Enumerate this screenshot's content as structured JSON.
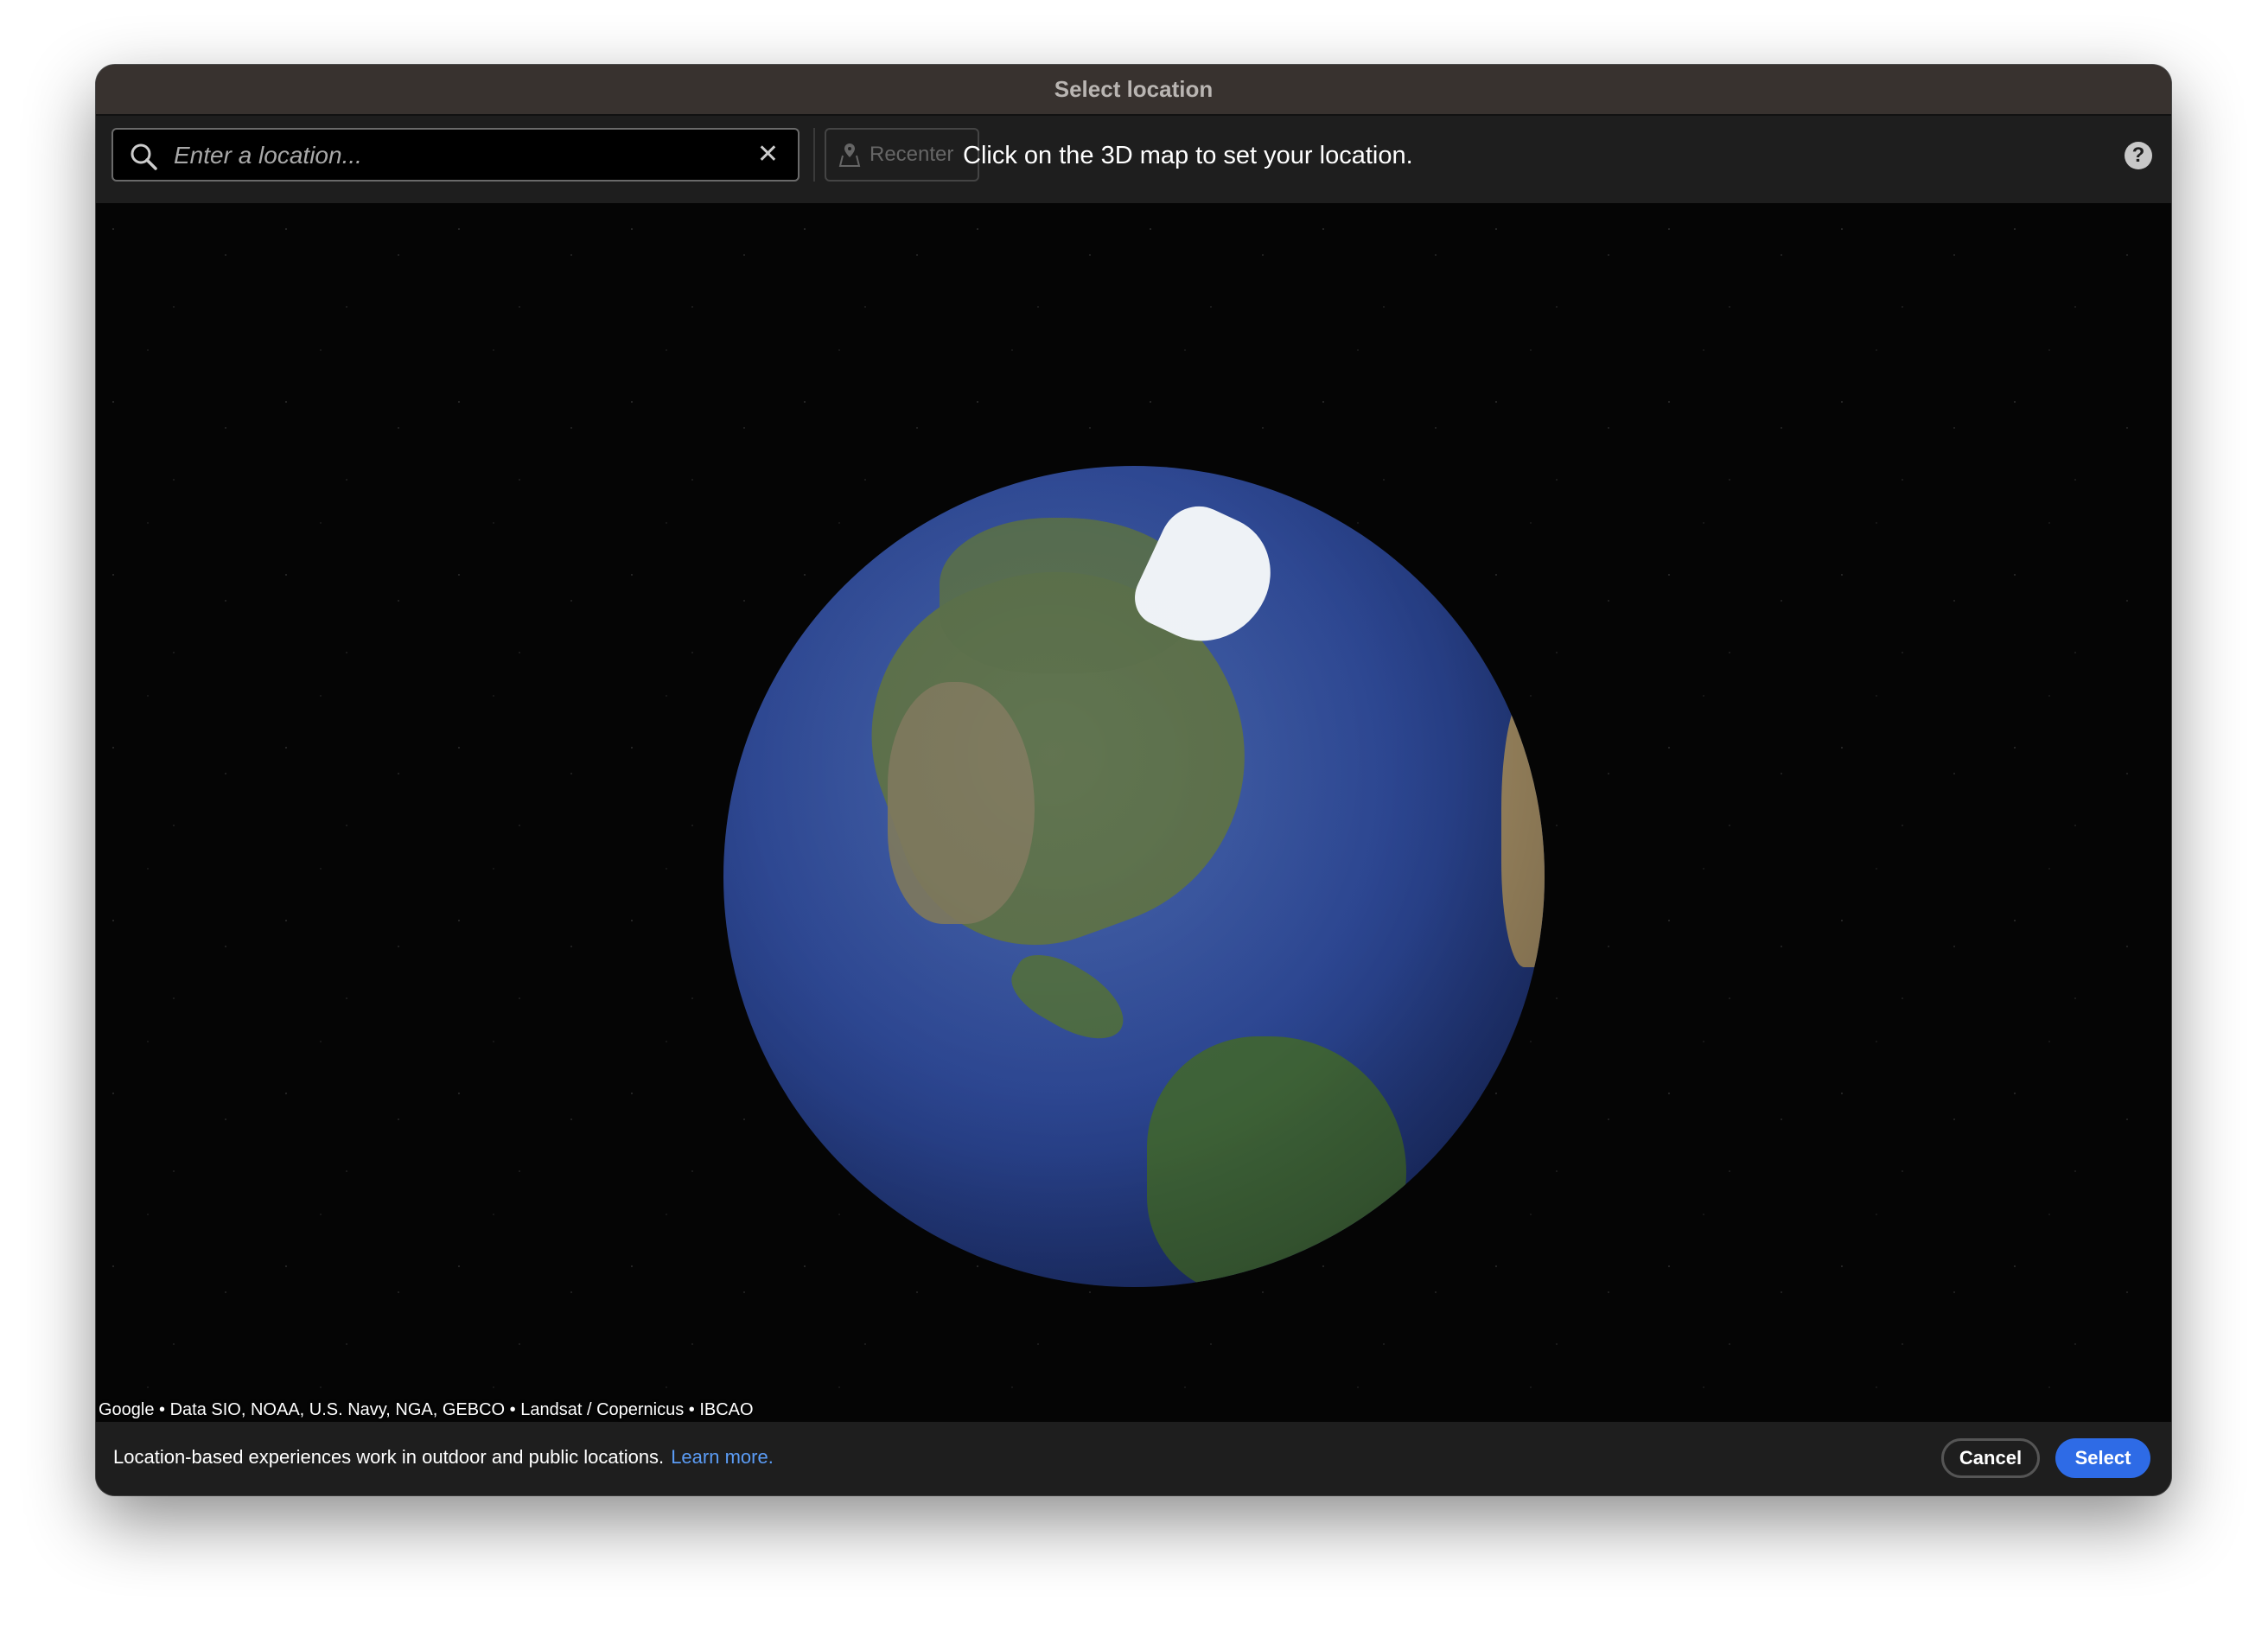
{
  "window": {
    "title": "Select location"
  },
  "toolbar": {
    "search": {
      "placeholder": "Enter a location...",
      "value": "",
      "clear_icon": "close-icon",
      "search_icon": "search-icon"
    },
    "recenter_label": "Recenter",
    "recenter_icon": "map-pin-icon",
    "instruction": "Click on the 3D map to set your location.",
    "help_icon": "help-icon",
    "help_glyph": "?"
  },
  "map": {
    "attribution": "Google • Data SIO, NOAA, U.S. Navy, NGA, GEBCO • Landsat / Copernicus • IBCAO"
  },
  "footer": {
    "note": "Location-based experiences work in outdoor and public locations.",
    "learn_more": "Learn more.",
    "cancel_label": "Cancel",
    "select_label": "Select"
  },
  "colors": {
    "accent": "#2e6be6",
    "link": "#5b9cf5",
    "titlebar": "#38322f",
    "panel": "#1e1e1e"
  }
}
